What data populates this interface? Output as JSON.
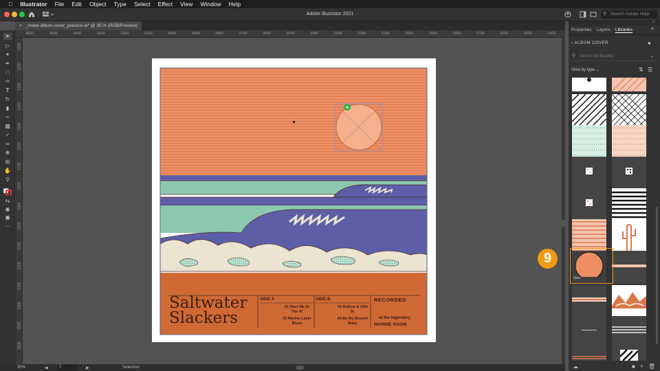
{
  "menubar": {
    "apple_icon": "apple-icon",
    "app_name": "Illustrator",
    "items": [
      "File",
      "Edit",
      "Object",
      "Type",
      "Select",
      "Effect",
      "View",
      "Window",
      "Help"
    ]
  },
  "titlebar": {
    "title": "Adobe Illustrator 2021",
    "search_placeholder": "Search Adobe Help"
  },
  "document_tab": {
    "label": "_make-album-cover_practice.ai* @ 35 % (RGB/Preview)"
  },
  "ruler_top": [
    "3600",
    "3500",
    "3400",
    "3300",
    "3200",
    "3100",
    "3000",
    "2900",
    "2800",
    "2700",
    "2600",
    "2500",
    "2400",
    "2300",
    "2200",
    "2100",
    "2000",
    "1900",
    "1800",
    "1700",
    "1600",
    "1500",
    "1400"
  ],
  "ruler_left": [
    "1100",
    "1200",
    "1300",
    "1400",
    "1500",
    "1600",
    "1700",
    "1800",
    "1900",
    "2000",
    "2100",
    "2200",
    "2300",
    "2400",
    "2500",
    "2600"
  ],
  "album": {
    "title_line1": "Saltwater",
    "title_line2": "Slackers",
    "side_a_label": "SIDE A",
    "side_a_tracks": [
      "01 Meet Me At The 47",
      "02 Marine Layer Blues"
    ],
    "side_b_label": "SIDE B",
    "side_b_tracks": [
      "03 Balboa & 15th St.",
      "04 Be My Brunch Baby"
    ],
    "recorded_label": "RECORDED",
    "recorded_text_line1": "at the legendary",
    "recorded_text_line2": "MARINE ROOM"
  },
  "statusbar": {
    "zoom": "35%",
    "artboard_number": "1",
    "tool_name": "Selection"
  },
  "panel": {
    "tabs": [
      "Properties",
      "Layers",
      "Libraries"
    ],
    "active_tab": "Libraries",
    "library_name": "ALBUM COVER",
    "search_placeholder": "Search all libraries",
    "view_by": "View by type",
    "selected_asset_label": "Sun"
  },
  "tutorial": {
    "step_number": "9"
  },
  "colors": {
    "sky_orange": "#ee8f63",
    "sun_peach": "#f6b08e",
    "sand_rust": "#cf6a34",
    "wave_blue": "#5c5fa8",
    "sea_green": "#8dc9b0",
    "foam_cream": "#ebe4d1",
    "outline_dark": "#4a2a22",
    "accent_orange": "#f29a12"
  }
}
